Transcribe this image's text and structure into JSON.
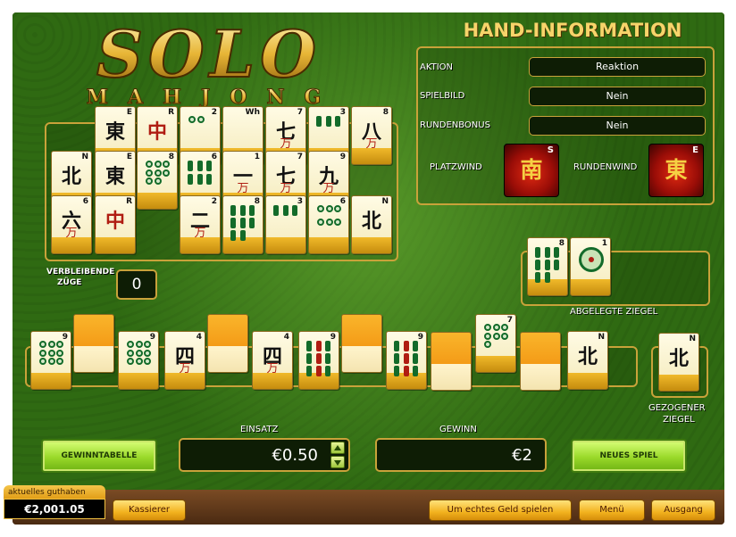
{
  "logo": {
    "title": "SOLO",
    "subtitle": "MAHJONG"
  },
  "hand_info": {
    "title": "HAND-INFORMATION",
    "rows": [
      {
        "label": "AKTION",
        "value": "Reaktion"
      },
      {
        "label": "SPIELBILD",
        "value": "Nein"
      },
      {
        "label": "RUNDENBONUS",
        "value": "Nein"
      }
    ],
    "platzwind_label": "PLATZWIND",
    "platzwind_char": "南",
    "platzwind_letter": "S",
    "rundenwind_label": "RUNDENWIND",
    "rundenwind_char": "東",
    "rundenwind_letter": "E"
  },
  "board": {
    "remaining_label_1": "VERBLEIBENDE",
    "remaining_label_2": "ZÜGE",
    "remaining_value": "0",
    "tiles": [
      {
        "main": "東",
        "num": "E"
      },
      {
        "main": "中",
        "num": "R",
        "cls": "red"
      },
      {
        "num": "2",
        "kind": "dots2"
      },
      {
        "main": "",
        "num": "Wh"
      },
      {
        "main": "七",
        "sub": "万",
        "num": "7"
      },
      {
        "num": "3",
        "kind": "bams3"
      },
      {
        "main": "八",
        "sub": "万",
        "num": "8"
      },
      {
        "main": "北",
        "num": "N"
      },
      {
        "main": "東",
        "num": "E"
      },
      {
        "num": "8",
        "kind": "dots8"
      },
      {
        "num": "6",
        "kind": "bams6"
      },
      {
        "main": "一",
        "sub": "万",
        "num": "1"
      },
      {
        "main": "七",
        "sub": "万",
        "num": "7"
      },
      {
        "main": "九",
        "sub": "万",
        "num": "9"
      },
      {
        "main": "六",
        "sub": "万",
        "num": "6"
      },
      {
        "main": "中",
        "num": "R",
        "cls": "red"
      },
      {
        "main": "二",
        "sub": "万",
        "num": "2"
      },
      {
        "num": "8",
        "kind": "bams8"
      },
      {
        "num": "3",
        "kind": "bams3"
      },
      {
        "num": "6",
        "kind": "dots6"
      },
      {
        "main": "北",
        "num": "N"
      }
    ]
  },
  "discarded": {
    "label": "ABGELEGTE ZIEGEL",
    "tiles": [
      {
        "num": "8",
        "kind": "bams8"
      },
      {
        "num": "1",
        "kind": "dots1"
      }
    ]
  },
  "hand": {
    "tiles": [
      {
        "num": "9",
        "kind": "dots9"
      },
      {
        "num": "9",
        "kind": "dots9"
      },
      {
        "main": "四",
        "sub": "万",
        "num": "4"
      },
      {
        "main": "四",
        "sub": "万",
        "num": "4"
      },
      {
        "num": "9",
        "kind": "bams9"
      },
      {
        "num": "9",
        "kind": "bams9"
      },
      {
        "num": "7",
        "kind": "dots7"
      },
      {
        "main": "北",
        "num": "N"
      }
    ],
    "drawn_label_1": "GEZOGENER",
    "drawn_label_2": "ZIEGEL",
    "drawn_tile": {
      "main": "北",
      "num": "N"
    }
  },
  "controls": {
    "paytable_label": "GEWINNTABELLE",
    "bet_label": "EINSATZ",
    "bet_value": "€0.50",
    "win_label": "GEWINN",
    "win_value": "€2",
    "new_game_label": "NEUES SPIEL"
  },
  "footer": {
    "balance_tab": "aktuelles guthaben",
    "balance_value": "€2,001.05",
    "cashier": "Kassierer",
    "real_money": "Um echtes Geld spielen",
    "menu": "Menü",
    "exit": "Ausgang"
  }
}
